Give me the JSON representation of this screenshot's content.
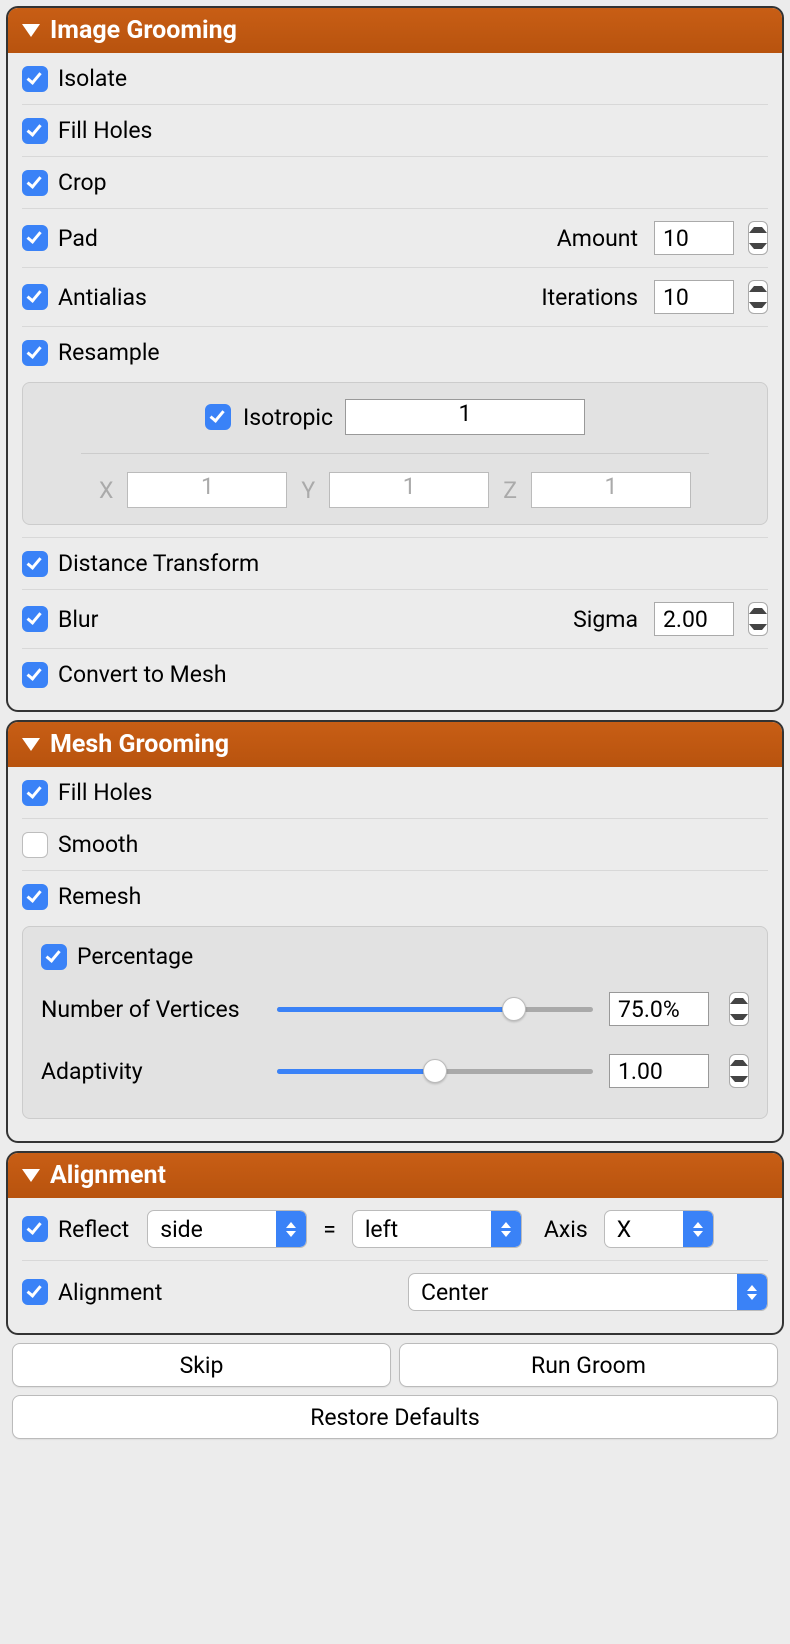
{
  "panels": {
    "image": {
      "title": "Image Grooming",
      "isolate": {
        "label": "Isolate",
        "checked": true
      },
      "fillHoles": {
        "label": "Fill Holes",
        "checked": true
      },
      "crop": {
        "label": "Crop",
        "checked": true
      },
      "pad": {
        "label": "Pad",
        "checked": true,
        "paramLabel": "Amount",
        "value": "10"
      },
      "antialias": {
        "label": "Antialias",
        "checked": true,
        "paramLabel": "Iterations",
        "value": "10"
      },
      "resample": {
        "label": "Resample",
        "checked": true,
        "isotropic": {
          "label": "Isotropic",
          "checked": true,
          "value": "1"
        },
        "x": {
          "label": "X",
          "value": "1"
        },
        "y": {
          "label": "Y",
          "value": "1"
        },
        "z": {
          "label": "Z",
          "value": "1"
        }
      },
      "distanceTransform": {
        "label": "Distance Transform",
        "checked": true
      },
      "blur": {
        "label": "Blur",
        "checked": true,
        "paramLabel": "Sigma",
        "value": "2.00"
      },
      "convertMesh": {
        "label": "Convert to Mesh",
        "checked": true
      }
    },
    "mesh": {
      "title": "Mesh Grooming",
      "fillHoles": {
        "label": "Fill Holes",
        "checked": true
      },
      "smooth": {
        "label": "Smooth",
        "checked": false
      },
      "remesh": {
        "label": "Remesh",
        "checked": true,
        "percentage": {
          "label": "Percentage",
          "checked": true
        },
        "vertices": {
          "label": "Number of Vertices",
          "value": "75.0%",
          "fillPct": 75
        },
        "adaptivity": {
          "label": "Adaptivity",
          "value": "1.00",
          "fillPct": 50
        }
      }
    },
    "alignment": {
      "title": "Alignment",
      "reflect": {
        "label": "Reflect",
        "checked": true,
        "side": "side",
        "eq": "=",
        "left": "left",
        "axisLabel": "Axis",
        "axis": "X"
      },
      "align": {
        "label": "Alignment",
        "checked": true,
        "value": "Center"
      }
    }
  },
  "buttons": {
    "skip": "Skip",
    "run": "Run Groom",
    "restore": "Restore Defaults"
  }
}
